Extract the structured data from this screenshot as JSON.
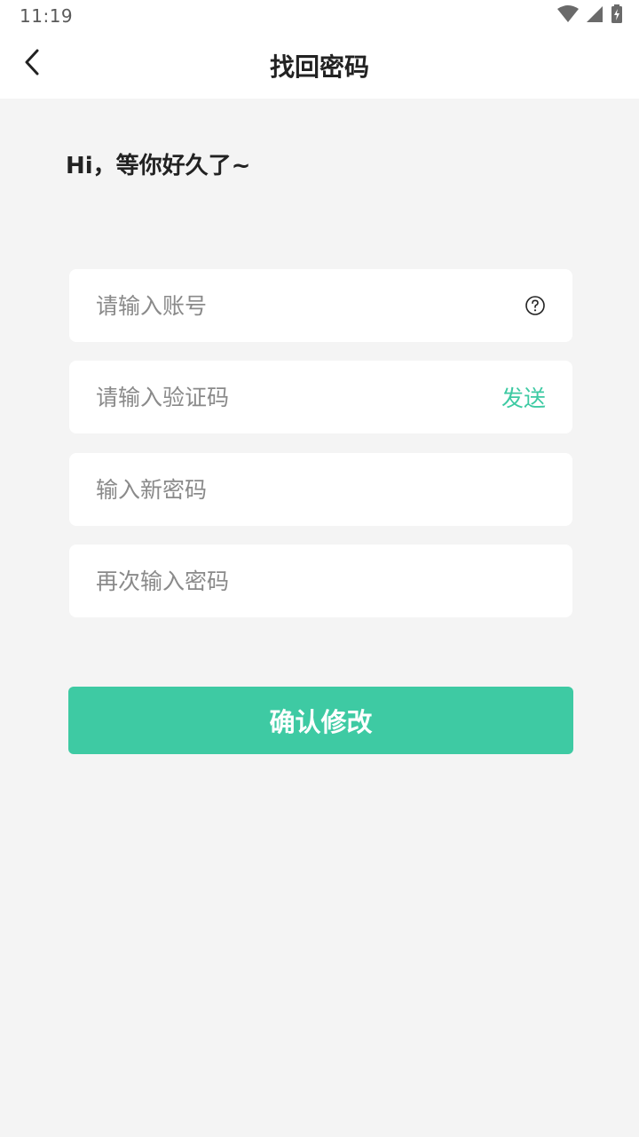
{
  "status_bar": {
    "time": "11:19",
    "icons": [
      "wifi-icon",
      "cellular-signal-icon",
      "battery-charging-icon"
    ]
  },
  "header": {
    "title": "找回密码",
    "back_icon": "chevron-left-icon"
  },
  "greeting": "Hi，等你好久了~",
  "form": {
    "account": {
      "value": "",
      "placeholder": "请输入账号",
      "help_icon": "question-circle-icon"
    },
    "code": {
      "value": "",
      "placeholder": "请输入验证码",
      "send_label": "发送"
    },
    "new_password": {
      "value": "",
      "placeholder": "输入新密码"
    },
    "confirm_password": {
      "value": "",
      "placeholder": "再次输入密码"
    },
    "submit_label": "确认修改"
  },
  "colors": {
    "accent": "#3ecaa3",
    "background": "#f4f4f4",
    "surface": "#ffffff",
    "title_text": "#222222",
    "placeholder_text": "#8a8a8a"
  }
}
